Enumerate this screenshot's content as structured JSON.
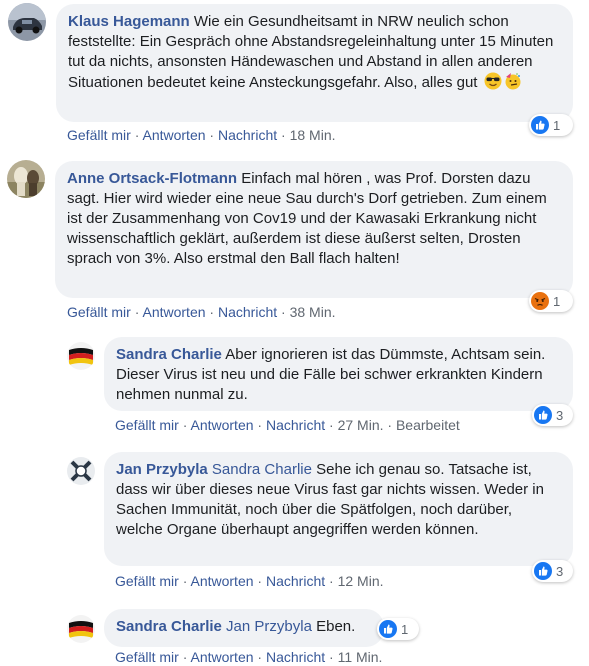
{
  "comments": [
    {
      "author": "Klaus Hagemann",
      "text": "Wie ein Gesundheitsamt in NRW neulich schon feststellte: Ein Gespräch ohne Abstandsregeleinhaltung unter 15 Minuten tut da nichts, ansonsten Händewaschen und Abstand in allen anderen Situationen bedeutet keine Ansteckungsgefahr. Also, alles gut",
      "emojis": [
        "sunglasses-face",
        "party-face"
      ],
      "actions": {
        "like": "Gefällt mir",
        "reply": "Antworten",
        "message": "Nachricht",
        "time": "18 Min."
      },
      "reaction": {
        "type": "like",
        "count": "1"
      }
    },
    {
      "author": "Anne Ortsack-Flotmann",
      "text": "Einfach mal hören , was Prof. Dorsten dazu sagt. Hier wird wieder eine neue Sau durch's Dorf getrieben. Zum einem ist der Zusammenhang von Cov19 und der Kawasaki Erkrankung nicht wissenschaftlich geklärt, außerdem ist diese äußerst selten, Drosten sprach von 3%. Also erstmal den Ball flach halten!",
      "actions": {
        "like": "Gefällt mir",
        "reply": "Antworten",
        "message": "Nachricht",
        "time": "38 Min."
      },
      "reaction": {
        "type": "angry",
        "count": "1"
      }
    },
    {
      "author": "Sandra Charlie",
      "text": "Aber ignorieren ist das Dümmste, Achtsam sein. Dieser Virus ist neu und die Fälle bei schwer erkrankten Kindern nehmen nunmal zu.",
      "actions": {
        "like": "Gefällt mir",
        "reply": "Antworten",
        "message": "Nachricht",
        "time": "27 Min.",
        "edited": "Bearbeitet"
      },
      "reaction": {
        "type": "like",
        "count": "3"
      }
    },
    {
      "author": "Jan Przybyla",
      "mention": "Sandra Charlie",
      "text": "Sehe ich genau so. Tatsache ist, dass wir über dieses neue Virus fast gar nichts wissen. Weder in Sachen Immunität, noch über die Spätfolgen, noch darüber, welche Organe überhaupt angegriffen werden können.",
      "actions": {
        "like": "Gefällt mir",
        "reply": "Antworten",
        "message": "Nachricht",
        "time": "12 Min."
      },
      "reaction": {
        "type": "like",
        "count": "3"
      }
    },
    {
      "author": "Sandra Charlie",
      "mention": "Jan Przybyla",
      "text": "Eben.",
      "actions": {
        "like": "Gefällt mir",
        "reply": "Antworten",
        "message": "Nachricht",
        "time": "11 Min."
      },
      "reaction": {
        "type": "like",
        "count": "1"
      }
    }
  ],
  "separator": "·",
  "colors": {
    "link": "#385898",
    "bubble": "#f0f2f5",
    "like": "#1877f2",
    "angry": "#e9710f"
  }
}
